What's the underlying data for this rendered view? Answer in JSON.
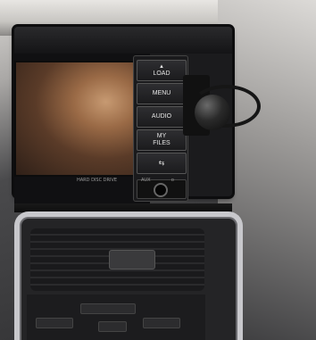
{
  "head_unit": {
    "buttons": [
      {
        "label": "LOAD",
        "icon": "eject-icon"
      },
      {
        "label": "MENU",
        "icon": ""
      },
      {
        "label": "AUDIO",
        "icon": ""
      },
      {
        "label": "MY\nFILES",
        "icon": ""
      },
      {
        "label": "",
        "icon": "usb-icon"
      }
    ],
    "strip_left": "HARD DISC DRIVE",
    "aux_label": "AUX",
    "aux_right": "ᴅ"
  }
}
